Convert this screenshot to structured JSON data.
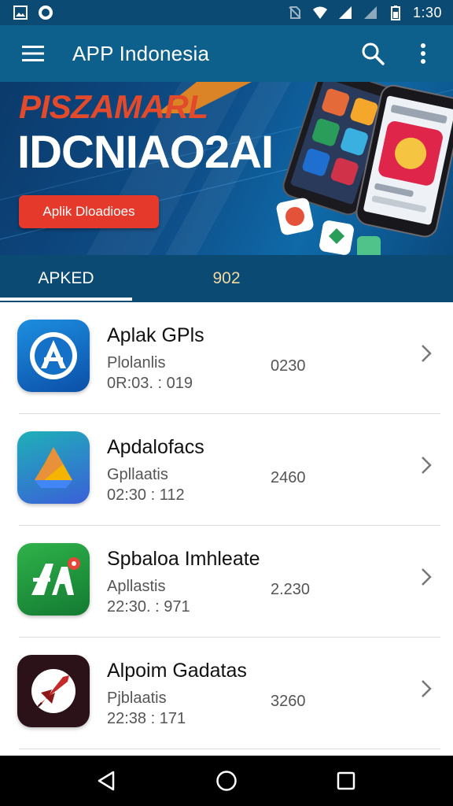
{
  "status_bar": {
    "time": "1:30",
    "icons": [
      "gallery-icon",
      "app-notification-icon",
      "no-sim-icon",
      "wifi-icon",
      "signal-icon",
      "signal-2-icon",
      "battery-icon"
    ]
  },
  "app_bar": {
    "title": "APP Indonesia",
    "icons": [
      "menu-icon",
      "search-icon",
      "more-vert-icon"
    ]
  },
  "banner": {
    "kicker": "PISZAMARL",
    "headline": "IDCNIAO2AI",
    "cta_label": "Aplik Dloadioes",
    "colors": {
      "cta": "#e5392b",
      "kicker": "#e24a2b"
    }
  },
  "tabs": [
    {
      "label": "APKED",
      "selected": true
    },
    {
      "label": "902",
      "selected": false
    }
  ],
  "apps": [
    {
      "title": "Aplak GPls",
      "subtitle": "Plolanlis",
      "meta": "0R:03. : 019",
      "value": "0230",
      "icon": "app-store-icon"
    },
    {
      "title": "Apdalofacs",
      "subtitle": "Gpllaatis",
      "meta": "02:30 : 112",
      "value": "2460",
      "icon": "drive-triangle-icon"
    },
    {
      "title": "Spbaloa Imhleate",
      "subtitle": "Apllastis",
      "meta": "22:30. : 971",
      "value": "2.230",
      "icon": "green-a-icon"
    },
    {
      "title": "Alpoim Gadatas",
      "subtitle": "Pjblaatis",
      "meta": "22:38 : 171",
      "value": "3260",
      "icon": "rocket-icon"
    }
  ],
  "nav_bar": {
    "icons": [
      "back-icon",
      "home-icon",
      "recents-icon"
    ]
  }
}
